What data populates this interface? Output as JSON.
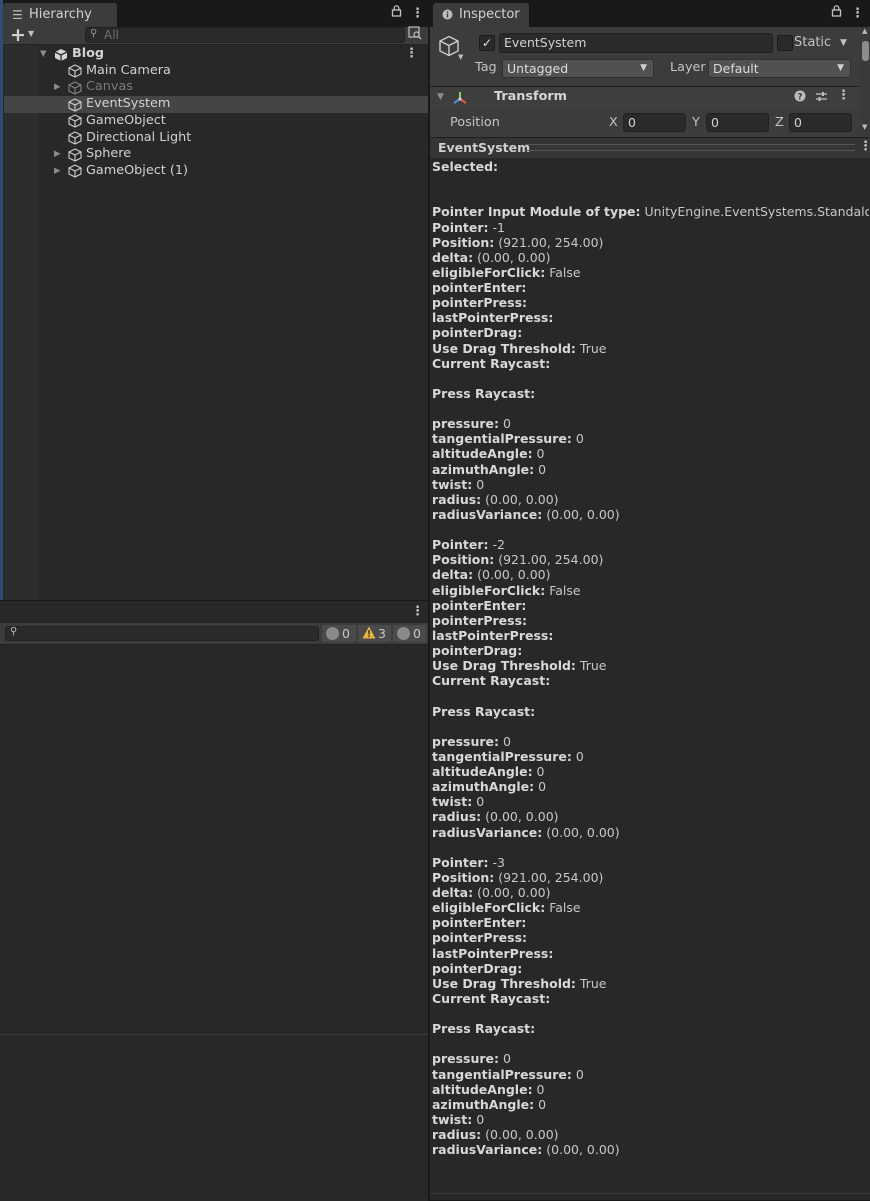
{
  "hierarchy": {
    "tab_title": "Hierarchy",
    "search_placeholder": "All",
    "add_button": "+",
    "items": [
      {
        "label": "Blog",
        "indent": 0,
        "expanded": true,
        "bold": true,
        "kind": "scene"
      },
      {
        "label": "Main Camera",
        "indent": 1
      },
      {
        "label": "Canvas",
        "indent": 1,
        "collapsed": true,
        "dim": true
      },
      {
        "label": "EventSystem",
        "indent": 1,
        "selected": true
      },
      {
        "label": "GameObject",
        "indent": 1
      },
      {
        "label": "Directional Light",
        "indent": 1
      },
      {
        "label": "Sphere",
        "indent": 1,
        "collapsed": true
      },
      {
        "label": "GameObject (1)",
        "indent": 1,
        "collapsed": true
      }
    ]
  },
  "console": {
    "info_count": "0",
    "warning_count": "3",
    "error_count": "0"
  },
  "inspector": {
    "tab_title": "Inspector",
    "object_name": "EventSystem",
    "active_checked": true,
    "static_label": "Static",
    "tag_label": "Tag",
    "tag_value": "Untagged",
    "layer_label": "Layer",
    "layer_value": "Default",
    "transform_title": "Transform",
    "position_label": "Position",
    "x_label": "X",
    "x_value": "0",
    "y_label": "Y",
    "y_value": "0",
    "z_label": "Z",
    "z_value": "0",
    "preview_title": "EventSystem",
    "module_text": "UnityEngine.EventSystems.StandaloneInputModule",
    "pointers": [
      {
        "id": "-1",
        "position": "(921.00, 254.00)",
        "delta": "(0.00, 0.00)"
      },
      {
        "id": "-2",
        "position": "(921.00, 254.00)",
        "delta": "(0.00, 0.00)"
      },
      {
        "id": "-3",
        "position": "(921.00, 254.00)",
        "delta": "(0.00, 0.00)"
      }
    ],
    "eligible_for_click": "False",
    "use_drag_threshold": "True",
    "pressure": "0",
    "tangential_pressure": "0",
    "altitude_angle": "0",
    "azimuth_angle": "0",
    "twist": "0",
    "radius": "(0.00, 0.00)",
    "radius_variance": "(0.00, 0.00)"
  },
  "colors": {
    "panel_bg": "#282828",
    "header_bg": "#3c3c3c",
    "selected_row": "#454545",
    "warning": "#e8b53b",
    "text": "#c8c8c8"
  }
}
